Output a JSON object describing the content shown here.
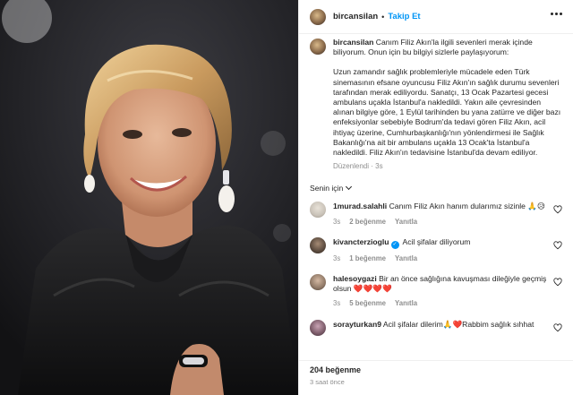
{
  "post": {
    "username": "bircansilan",
    "separator": "•",
    "follow_label": "Takip Et"
  },
  "caption": {
    "username": "bircansilan",
    "line1": "Canım Filiz Akın'la ilgili sevenleri merak içinde biliyorum. Onun için bu bilgiyi sizlerle paylaşıyorum:",
    "paragraph": "Uzun zamandır sağlık problemleriyle mücadele eden Türk sinemasının efsane oyuncusu Filiz Akın'ın sağlık durumu sevenleri tarafından merak ediliyordu. Sanatçı, 13 Ocak Pazartesi gecesi ambulans uçakla İstanbul'a nakledildi. Yakın aile çevresinden alınan bilgiye göre, 1 Eylül tarihinden bu yana zatürre ve diğer bazı enfeksiyonlar sebebiyle Bodrum'da tedavi gören Filiz Akın, acil ihtiyaç üzerine, Cumhurbaşkanlığı'nın yönlendirmesi ile Sağlık Bakanlığı'na ait bir ambulans uçakla 13 Ocak'ta İstanbul'a nakledildi. Filiz Akın'ın tedavisine İstanbul'da devam ediliyor.",
    "meta": "Düzenlendi · 3s"
  },
  "sort": {
    "label": "Senin için"
  },
  "comments": [
    {
      "username": "1murad.salahli",
      "text": "Canım Filiz Akın hanım dularımız sizinle 🙏😥",
      "time": "3s",
      "likes": "2 beğenme",
      "reply": "Yanıtla",
      "avatar_color": "#c9c2b8"
    },
    {
      "username": "kivancterzioglu",
      "text": "Acil şifalar diliyorum",
      "time": "3s",
      "likes": "1 beğenme",
      "reply": "Yanıtla",
      "avatar_color": "#5a4a3e",
      "verified": true
    },
    {
      "username": "halesoygazi",
      "text": "Bir an önce sağlığına kavuşması dileğiyle geçmiş olsun ❤️❤️❤️❤️",
      "time": "3s",
      "likes": "5 beğenme",
      "reply": "Yanıtla",
      "avatar_color": "#8f7866"
    },
    {
      "username": "sorayturkan9",
      "text": "Acil şifalar dilerim🙏❤️Rabbim sağlık sıhhat",
      "time": "",
      "likes": "",
      "reply": "",
      "avatar_color": "#7a5a68"
    }
  ],
  "footer": {
    "likes": "204 beğenme",
    "ago": "3 saat önce"
  },
  "colors": {
    "accent": "#0095f6",
    "muted": "#8e8e8e",
    "text": "#262626"
  },
  "icons": [
    "more-options-icon",
    "heart-icon",
    "verified-badge-icon",
    "chevron-down-icon"
  ]
}
